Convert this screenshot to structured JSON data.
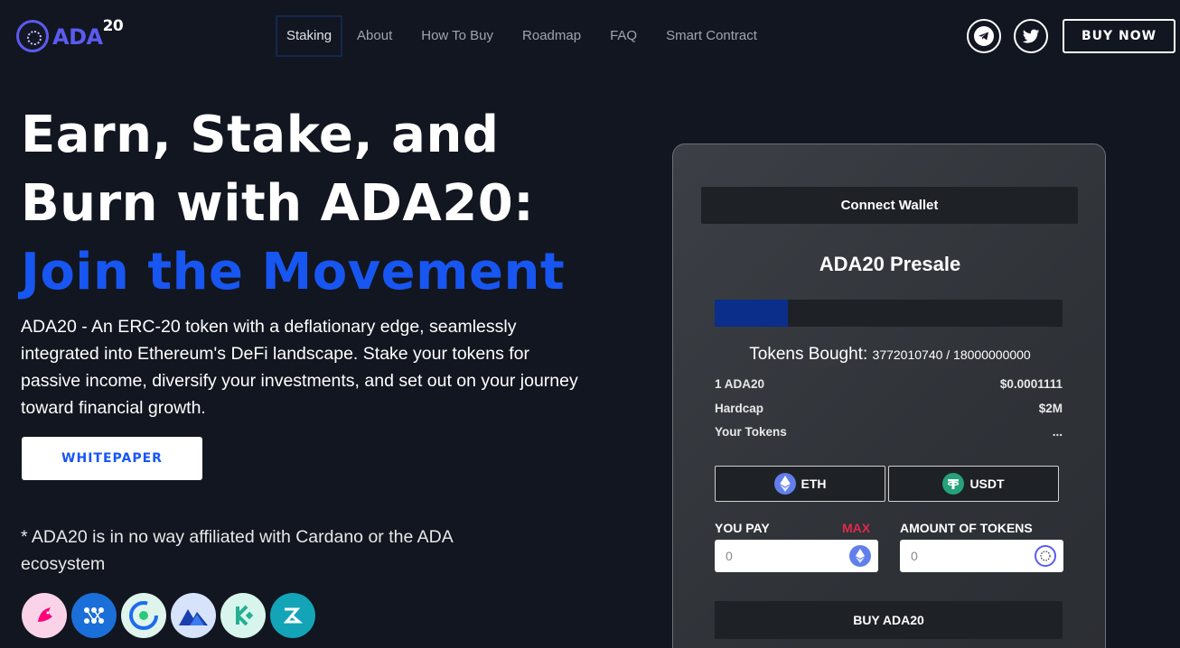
{
  "brand": {
    "name": "ADA",
    "sup": "20"
  },
  "nav": [
    {
      "label": "Staking",
      "active": true
    },
    {
      "label": "About"
    },
    {
      "label": "How To Buy"
    },
    {
      "label": "Roadmap"
    },
    {
      "label": "FAQ"
    },
    {
      "label": "Smart Contract"
    }
  ],
  "header": {
    "buy_now": "BUY NOW",
    "social": [
      "telegram-icon",
      "twitter-icon"
    ]
  },
  "hero": {
    "title_line1": "Earn, Stake, and",
    "title_line2": "Burn with ADA20:",
    "title_accent": "Join the Movement",
    "description": "ADA20 - An ERC-20 token with a deflationary edge, seamlessly integrated into Ethereum's DeFi landscape. Stake your tokens for passive income, diversify your investments, and set out on your journey toward financial growth.",
    "whitepaper": "WHITEPAPER",
    "disclaimer": "* ADA20 is in no way affiliated with Cardano or the ADA ecosystem",
    "partners": [
      "uniswap-icon",
      "1inch-icon",
      "coingecko-icon",
      "mexc-icon",
      "kucoin-icon",
      "bitmart-icon"
    ]
  },
  "presale": {
    "connect_wallet": "Connect Wallet",
    "title": "ADA20 Presale",
    "progress_fraction": 0.2096,
    "tokens_bought_label": "Tokens Bought:",
    "tokens_bought_value": "3772010740 / 18000000000",
    "rows": [
      {
        "label": "1 ADA20",
        "value": "$0.0001111"
      },
      {
        "label": "Hardcap",
        "value": "$2M"
      },
      {
        "label": "Your Tokens",
        "value": "..."
      }
    ],
    "tabs": [
      "ETH",
      "USDT"
    ],
    "you_pay_label": "YOU PAY",
    "max_label": "MAX",
    "amount_label": "AMOUNT OF TOKENS",
    "you_pay_placeholder": "0",
    "amount_placeholder": "0",
    "buy_button": "BUY ADA20"
  },
  "colors": {
    "background": "#121620",
    "accent": "#1856f2",
    "brand": "#5b5bf0",
    "max": "#e0284a",
    "progress": "#0a2e8a"
  }
}
